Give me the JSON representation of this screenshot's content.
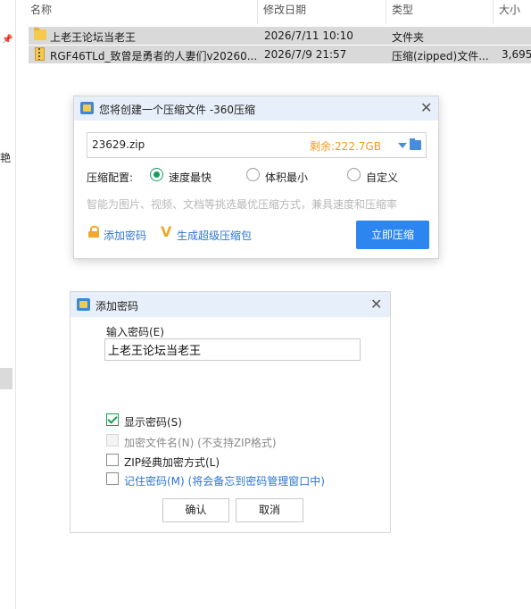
{
  "explorer": {
    "columns": {
      "name": "名称",
      "modified": "修改日期",
      "type": "类型",
      "size": "大小"
    },
    "side_char": "艳",
    "rows": [
      {
        "name": "上老王论坛当老王",
        "modified": "2026/7/11 10:10",
        "type": "文件夹",
        "size": "",
        "icon": "folder-icon"
      },
      {
        "name": "RGF46TLd_致曾是勇者的人妻们v20260...",
        "modified": "2026/7/9 21:57",
        "type": "压缩(zipped)文件...",
        "size": "3,695",
        "icon": "zip-file-icon"
      }
    ]
  },
  "compress_dialog": {
    "title": "您将创建一个压缩文件 -360压缩",
    "file_name": "23629.zip",
    "free_space": "剩余:222.7GB",
    "config_label": "压缩配置:",
    "options": [
      "速度最快",
      "体积最小",
      "自定义"
    ],
    "selected_option": "速度最快",
    "hint": "智能为图片、视频、文档等挑选最优压缩方式，兼具速度和压缩率",
    "add_password": "添加密码",
    "super_package": "生成超级压缩包",
    "compress_button": "立即压缩",
    "accent_color": "#2d86f0"
  },
  "password_dialog": {
    "title": "添加密码",
    "input_label": "输入密码(E)",
    "password_value": "上老王论坛当老王",
    "checkboxes": [
      {
        "label": "显示密码(S)",
        "checked": true,
        "enabled": true
      },
      {
        "label": "加密文件名(N) (不支持ZIP格式)",
        "checked": false,
        "enabled": false
      },
      {
        "label": "ZIP经典加密方式(L)",
        "checked": false,
        "enabled": true
      },
      {
        "label": "记住密码(M) (将会备忘到密码管理窗口中)",
        "checked": false,
        "enabled": true
      }
    ],
    "ok_button": "确认",
    "cancel_button": "取消"
  }
}
